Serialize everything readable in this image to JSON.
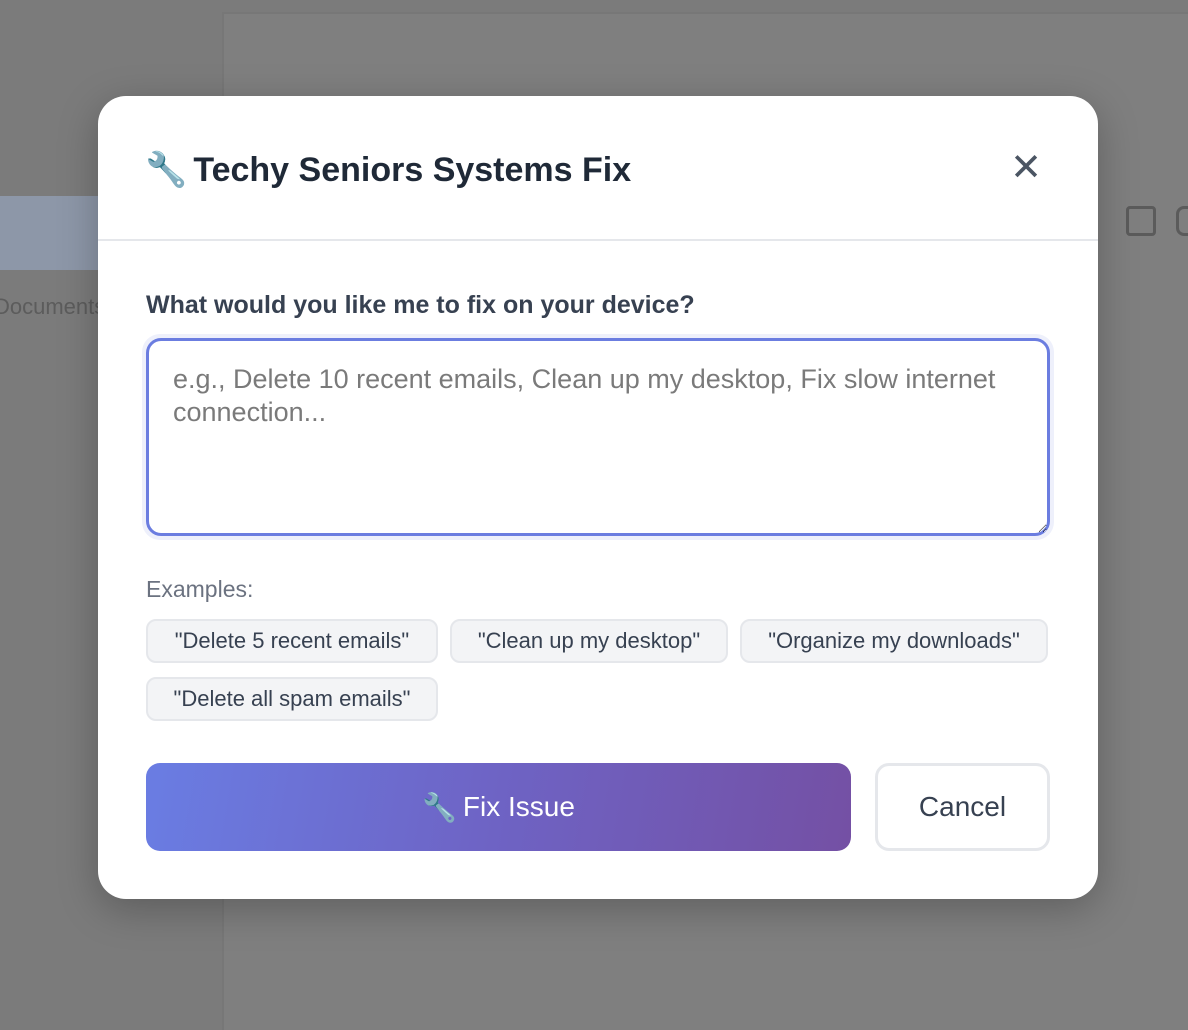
{
  "background": {
    "sidebar_text": "Documents"
  },
  "modal": {
    "title_icon": "🔧",
    "title": "Techy Seniors Systems Fix",
    "close_label": "✕",
    "field_label": "What would you like me to fix on your device?",
    "textarea": {
      "value": "",
      "placeholder": "e.g., Delete 10 recent emails, Clean up my desktop, Fix slow internet connection..."
    },
    "examples_label": "Examples:",
    "examples": [
      "\"Delete 5 recent emails\"",
      "\"Clean up my desktop\"",
      "\"Organize my downloads\"",
      "\"Delete all spam emails\""
    ],
    "primary_icon": "🔧",
    "primary_label": "Fix Issue",
    "cancel_label": "Cancel"
  },
  "colors": {
    "accent_start": "#6a7de3",
    "accent_end": "#7450a4",
    "focus_border": "#6b7de0"
  }
}
